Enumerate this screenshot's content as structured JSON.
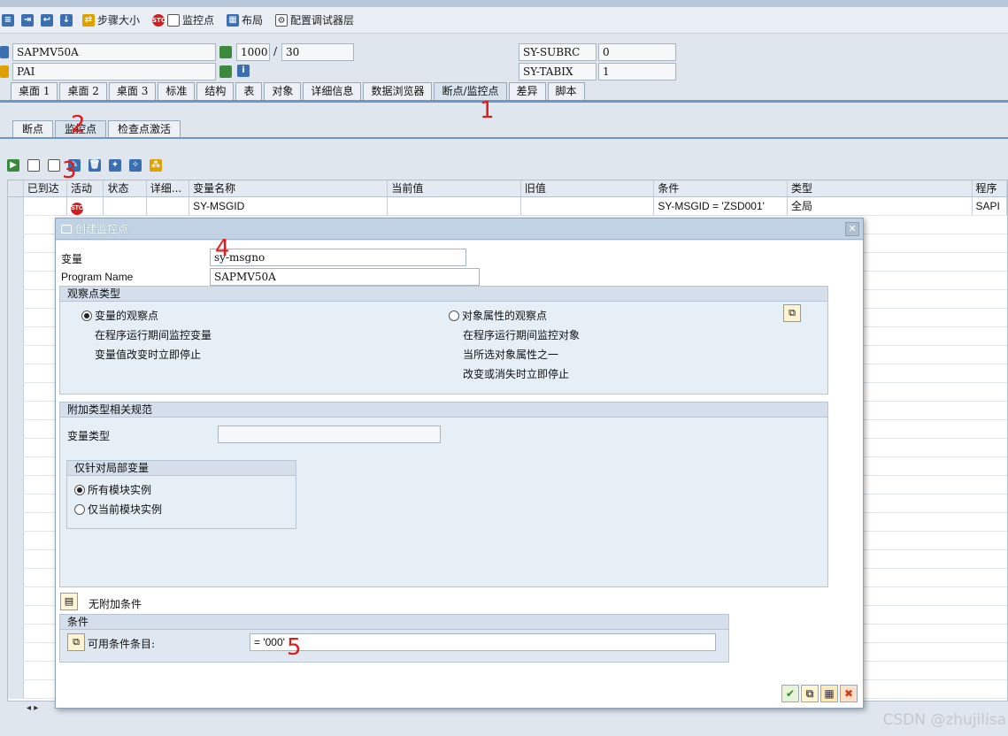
{
  "toolbar": {
    "step_size": "步骤大小",
    "watchpoint": "监控点",
    "layout": "布局",
    "config_layers": "配置调试器层"
  },
  "header": {
    "program": "SAPMV50A",
    "event": "PAI",
    "screen_no": "1000",
    "line_no": "30",
    "sep": "/",
    "subrc_label": "SY-SUBRC",
    "subrc_value": "0",
    "tabix_label": "SY-TABIX",
    "tabix_value": "1"
  },
  "tabs": [
    "桌面 1",
    "桌面 2",
    "桌面 3",
    "标准",
    "结构",
    "表",
    "对象",
    "详细信息",
    "数据浏览器",
    "断点/监控点",
    "差异",
    "脚本"
  ],
  "subtabs": [
    "断点",
    "监控点",
    "检查点激活"
  ],
  "grid": {
    "columns": [
      "已到达",
      "活动",
      "状态",
      "详细...",
      "变量名称",
      "当前值",
      "旧值",
      "条件",
      "类型",
      "程序"
    ],
    "rows": [
      {
        "variable": "SY-MSGID",
        "current": "",
        "old": "",
        "condition": "SY-MSGID = 'ZSD001'",
        "type": "全局",
        "program": "SAPI"
      }
    ]
  },
  "dialog": {
    "title": "创建监控点",
    "variable_label": "变量",
    "variable_value": "sy-msgno",
    "program_label": "Program Name",
    "program_value": "SAPMV50A",
    "wp_type_title": "观察点类型",
    "opt_variable": "变量的观察点",
    "opt_variable_desc1": "在程序运行期间监控变量",
    "opt_variable_desc2": "变量值改变时立即停止",
    "opt_object": "对象属性的观察点",
    "opt_object_desc1": "在程序运行期间监控对象",
    "opt_object_desc2": "当所选对象属性之一",
    "opt_object_desc3": "改变或消失时立即停止",
    "extra_title": "附加类型相关规范",
    "var_type_label": "变量类型",
    "local_title": "仅针对局部变量",
    "opt_all": "所有模块实例",
    "opt_current": "仅当前模块实例",
    "no_cond": "无附加条件",
    "cond_title": "条件",
    "cond_label": "可用条件条目:",
    "cond_value": "= '000'"
  },
  "annotations": [
    "1",
    "2",
    "3",
    "4",
    "5"
  ],
  "watermark": "CSDN @zhujilisa"
}
